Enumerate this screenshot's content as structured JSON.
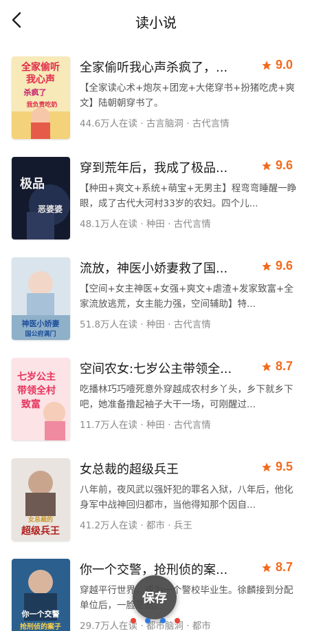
{
  "header": {
    "title": "读小说",
    "back_icon": "chevron-left-icon"
  },
  "rating_color": "#f26b1d",
  "books": [
    {
      "title": "全家偷听我心声杀疯了，...",
      "rating": "9.0",
      "desc": "【全家读心术+炮灰+团宠+大佬穿书+扮猪吃虎+爽文】陆朝朝穿书了。",
      "meta": "44.6万人在读 · 古言脑洞 · 古代言情",
      "cover_text": [
        "全家偷听",
        "我心声",
        "杀疯了",
        "我负责吃奶"
      ]
    },
    {
      "title": "穿到荒年后，我成了极品...",
      "rating": "9.6",
      "desc": "【种田+爽文+系统+萌宝+无男主】程弯弯睡醒一睁眼，成了古代大河村33岁的农妇。四个儿...",
      "meta": "48.1万人在读 · 种田 · 古代言情",
      "cover_text": [
        "极品",
        "恶婆婆"
      ]
    },
    {
      "title": "流放，神医小娇妻救了国...",
      "rating": "9.6",
      "desc": "【空间+女主神医+女强+爽文+虐渣+发家致富+全家流放逃荒，女主能力强，空间辅助】特...",
      "meta": "51.8万人在读 · 种田 · 古代言情",
      "cover_text": [
        "神医小娇妻",
        "国公府满门"
      ]
    },
    {
      "title": "空间农女:七岁公主带领全...",
      "rating": "8.7",
      "desc": "吃播林巧巧噎死意外穿越成农村乡丫头，乡下就乡下吧，她准备撸起袖子大干一场，可刚醒过...",
      "meta": "11.7万人在读 · 种田 · 古代言情",
      "cover_text": [
        "七岁公主",
        "带领全村",
        "致富"
      ]
    },
    {
      "title": "女总裁的超级兵王",
      "rating": "9.5",
      "desc": "八年前，夜风武以强奸犯的罪名入狱，八年后，他化身军中战神回归都市，当他得知那个因自...",
      "meta": "41.2万人在读 · 都市 · 兵王",
      "cover_text": [
        "女总裁的",
        "超级兵王"
      ]
    },
    {
      "title": "你一个交警，抢刑侦的案...",
      "rating": "8.7",
      "desc": "穿越平行世界，成为一个警校毕业生。徐麟接到分配单位后，一脸茫然。",
      "meta": "29.7万人在读 · 都市脑洞 · 都市",
      "cover_text": [
        "你一个交警",
        "抢刑侦的案子"
      ]
    }
  ],
  "floating_button": {
    "label": "保存"
  },
  "pager_dots": [
    "#e8453c",
    "#2d7be0",
    "#2d7be0",
    "#e8453c"
  ]
}
